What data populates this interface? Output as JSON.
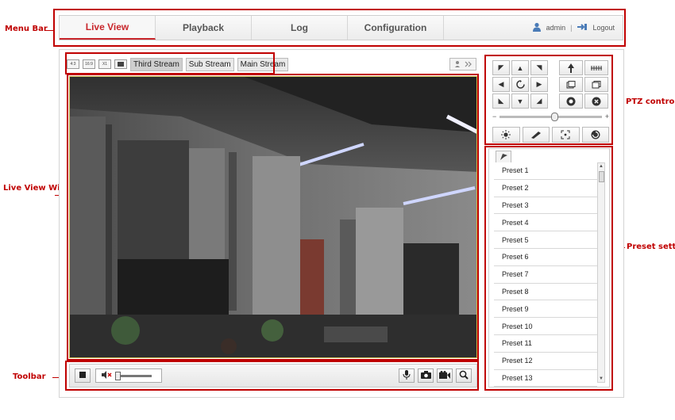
{
  "annotations": {
    "menu_bar": "Menu Bar",
    "live_view_window": "Live View Window",
    "toolbar": "Toolbar",
    "ptz_control": "PTZ control",
    "preset_setting": "Preset setting"
  },
  "menu": {
    "tabs": [
      "Live View",
      "Playback",
      "Log",
      "Configuration"
    ],
    "active_tab": "Live View",
    "user": "admin",
    "separator": "|",
    "logout": "Logout"
  },
  "stream": {
    "ratio_buttons": [
      "4:3",
      "16:9",
      "X1"
    ],
    "streams": [
      "Third Stream",
      "Sub Stream",
      "Main Stream"
    ],
    "active_stream": "Third Stream"
  },
  "presets": [
    "Preset 1",
    "Preset 2",
    "Preset 3",
    "Preset 4",
    "Preset 5",
    "Preset 6",
    "Preset 7",
    "Preset 8",
    "Preset 9",
    "Preset 10",
    "Preset 11",
    "Preset 12",
    "Preset 13"
  ],
  "colors": {
    "accent": "#c8262b",
    "annotation": "#c00000"
  },
  "icons": {
    "user": "user-icon",
    "logout": "logout-icon",
    "stop": "stop-icon",
    "volume": "speaker-muted-icon",
    "mic": "microphone-icon",
    "capture": "camera-icon",
    "record": "video-camera-icon",
    "zoom": "magnifier-icon"
  },
  "ptz": {
    "speed_minus": "−",
    "speed_plus": "+"
  }
}
